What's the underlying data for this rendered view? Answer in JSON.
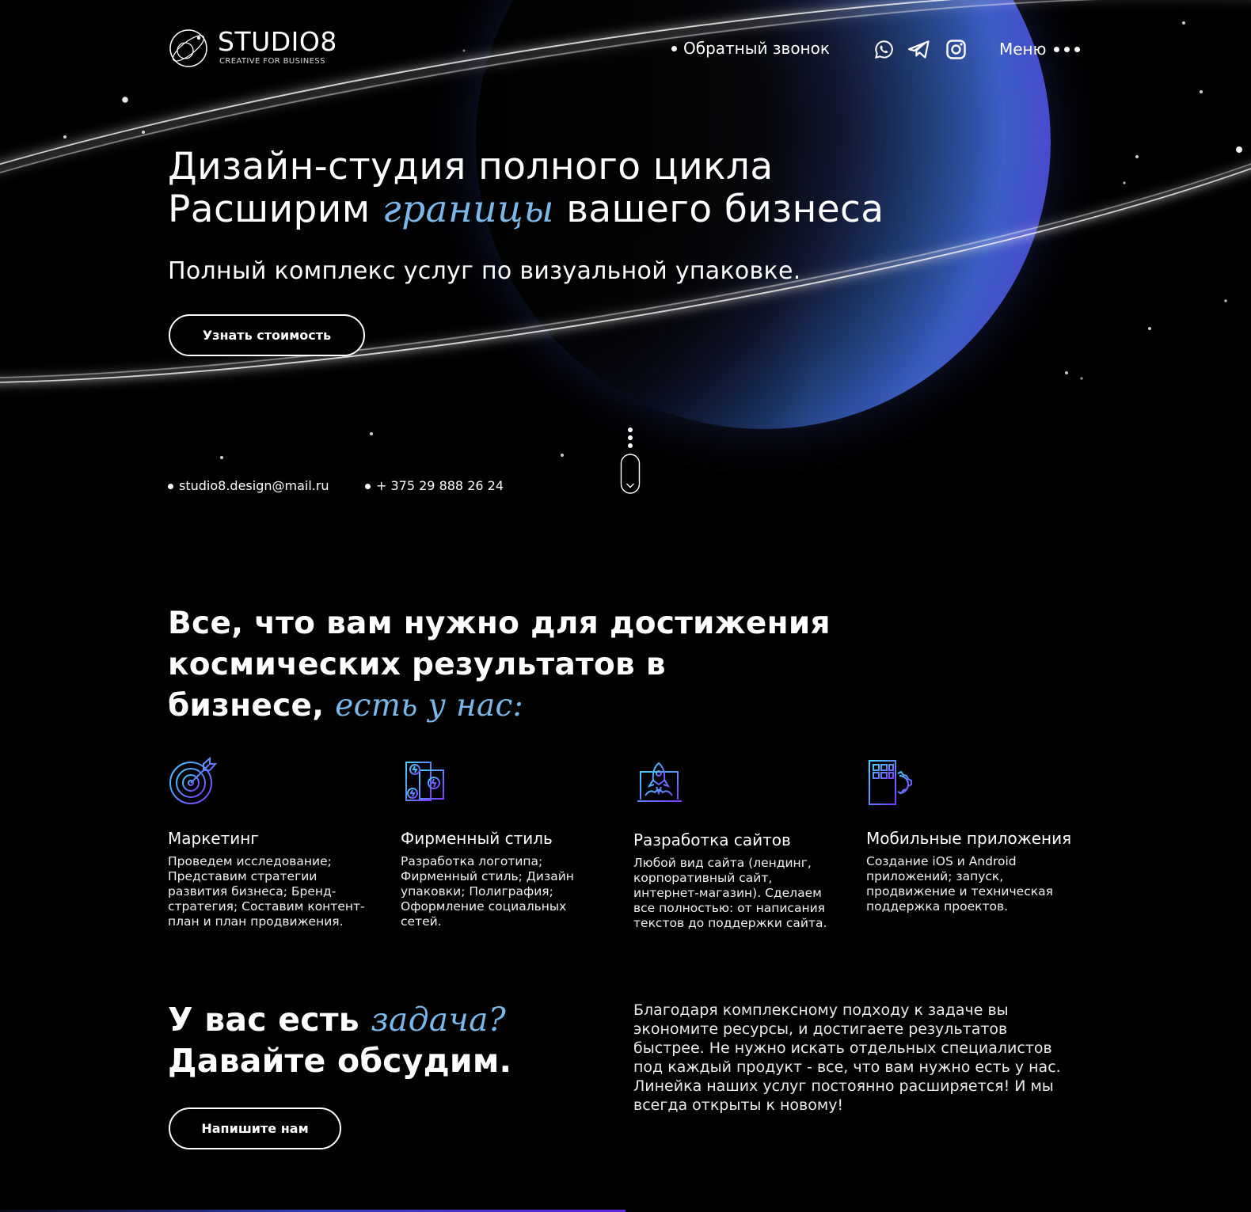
{
  "header": {
    "logo_title": "STUDIO8",
    "logo_subtitle": "CREATIVE FOR BUSINESS",
    "callback_label": "Обратный звонок",
    "menu_label": "Меню",
    "social_icons": [
      "whatsapp-icon",
      "telegram-icon",
      "instagram-icon"
    ]
  },
  "hero": {
    "title_line1": "Дизайн-студия полного цикла",
    "title_line2_start": "Расширим",
    "title_line2_accent": "границы",
    "title_line2_end": "вашего бизнеса",
    "subtitle": "Полный комплекс услуг по визуальной упаковке.",
    "cta_label": "Узнать стоимость"
  },
  "contacts": {
    "email": "studio8.design@mail.ru",
    "phone": "+ 375 29 888 26 24"
  },
  "services_section": {
    "title_line1": "Все, что вам нужно для достижения",
    "title_line2": "космических результатов в",
    "title_line3_start": "бизнесе,",
    "title_line3_accent": "есть у нас:",
    "items": [
      {
        "icon": "target-icon",
        "title": "Маркетинг",
        "description": "Проведем исследование; Представим стратегии развития бизнеса; Бренд-стратегия; Составим контент-план и план продвижения."
      },
      {
        "icon": "brand-style-icon",
        "title": "Фирменный стиль",
        "description": "Разработка логотипа; Фирменный стиль; Дизайн упаковки; Полиграфия; Оформление социальных сетей."
      },
      {
        "icon": "rocket-laptop-icon",
        "title": "Разработка сайтов",
        "description": "Любой вид сайта (лендинг, корпоративный сайт, интернет-магазин). Сделаем все полностью: от написания текстов до поддержки сайта."
      },
      {
        "icon": "mobile-app-icon",
        "title": "Мобильные приложения",
        "description": "Создание iOS и Android приложений; запуск, продвижение и техническая поддержка проектов."
      }
    ]
  },
  "task_section": {
    "title_line1_start": "У вас есть",
    "title_line1_accent": "задача?",
    "title_line2": "Давайте обсудим.",
    "cta_label": "Напишите нам",
    "description": "Благодаря комплексному подходу к задаче вы экономите ресурсы, и достигаете результатов быстрее. Не нужно искать отдельных специалистов под каждый продукт - все, что вам нужно есть у нас. Линейка наших услуг постоянно расширяется! И мы всегда открыты к новому!"
  },
  "colors": {
    "background": "#000000",
    "accent_text": "#7bb8e9",
    "planet_blue": "#3b5ec4",
    "planet_violet": "#5e2ae0"
  }
}
